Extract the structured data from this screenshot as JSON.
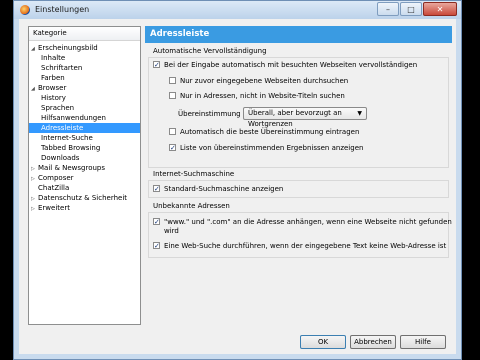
{
  "window": {
    "title": "Einstellungen"
  },
  "sidebar": {
    "header": "Kategorie",
    "items": [
      {
        "label": "Erscheinungsbild",
        "level": 1,
        "arrow": "open"
      },
      {
        "label": "Inhalte",
        "level": 2
      },
      {
        "label": "Schriftarten",
        "level": 2
      },
      {
        "label": "Farben",
        "level": 2
      },
      {
        "label": "Browser",
        "level": 1,
        "arrow": "open"
      },
      {
        "label": "History",
        "level": 2
      },
      {
        "label": "Sprachen",
        "level": 2
      },
      {
        "label": "Hilfsanwendungen",
        "level": 2
      },
      {
        "label": "Adressleiste",
        "level": 2,
        "selected": true
      },
      {
        "label": "Internet-Suche",
        "level": 2
      },
      {
        "label": "Tabbed Browsing",
        "level": 2
      },
      {
        "label": "Downloads",
        "level": 2
      },
      {
        "label": "Mail & Newsgroups",
        "level": 1,
        "arrow": "closed"
      },
      {
        "label": "Composer",
        "level": 1,
        "arrow": "closed"
      },
      {
        "label": "ChatZilla",
        "level": 1
      },
      {
        "label": "Datenschutz & Sicherheit",
        "level": 1,
        "arrow": "closed"
      },
      {
        "label": "Erweitert",
        "level": 1,
        "arrow": "closed"
      }
    ]
  },
  "main": {
    "header": "Adressleiste",
    "autocomplete": {
      "title": "Automatische Vervollständigung",
      "enable": {
        "label": "Bei der Eingabe automatisch mit besuchten Webseiten vervollständigen",
        "checked": true
      },
      "only_typed": {
        "label": "Nur zuvor eingegebene Webseiten durchsuchen",
        "checked": false
      },
      "only_urls": {
        "label": "Nur in Adressen, nicht in Website-Titeln suchen",
        "checked": false
      },
      "match_label": "Übereinstimmung",
      "match_value": "Überall, aber bevorzugt an Wortgrenzen",
      "auto_best": {
        "label": "Automatisch die beste Übereinstimmung eintragen",
        "checked": false
      },
      "show_list": {
        "label": "Liste von übereinstimmenden Ergebnissen anzeigen",
        "checked": true
      }
    },
    "search": {
      "title": "Internet-Suchmaschine",
      "default_engine": {
        "label": "Standard-Suchmaschine anzeigen",
        "checked": true
      }
    },
    "unknown": {
      "title": "Unbekannte Adressen",
      "append_www_line1": "\"www.\" und \".com\" an die Adresse anhängen, wenn eine Webseite nicht gefunden",
      "append_www_line2": "wird",
      "append_www_checked": true,
      "web_search": {
        "label": "Eine Web-Suche durchführen, wenn der eingegebene Text keine Web-Adresse ist",
        "checked": true
      }
    }
  },
  "buttons": {
    "ok": "OK",
    "cancel": "Abbrechen",
    "help": "Hilfe"
  }
}
